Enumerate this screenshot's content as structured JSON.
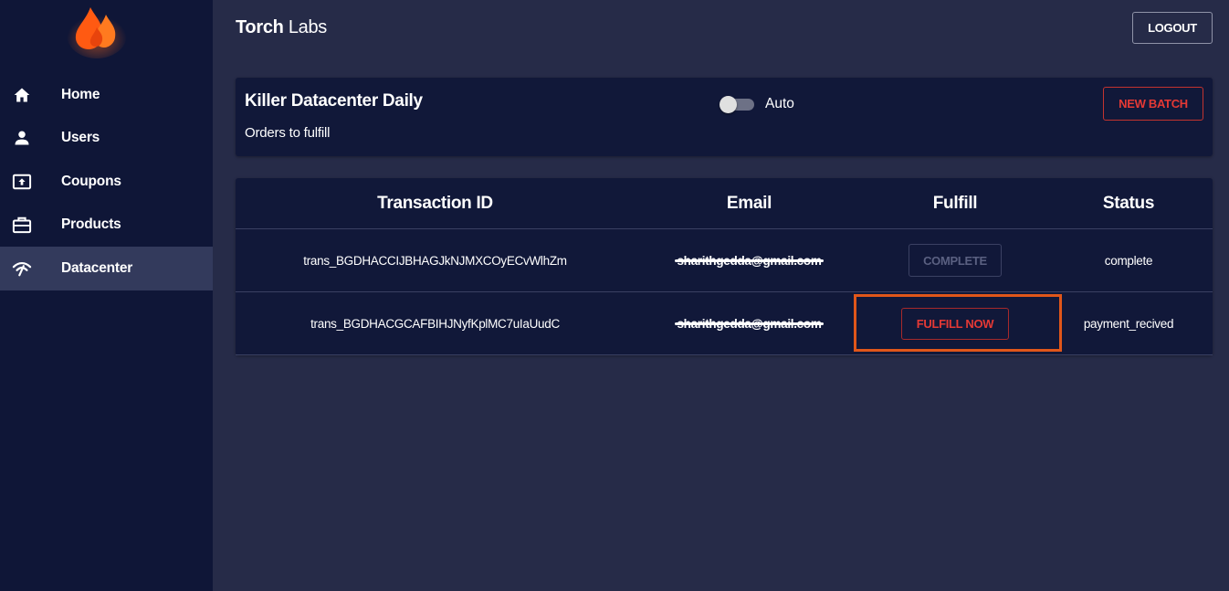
{
  "sidebar": {
    "logo_icon": "flame-logo-icon",
    "items": [
      {
        "label": "Home",
        "icon": "home-icon",
        "active": false
      },
      {
        "label": "Users",
        "icon": "user-icon",
        "active": false
      },
      {
        "label": "Coupons",
        "icon": "coupon-icon",
        "active": false
      },
      {
        "label": "Products",
        "icon": "briefcase-icon",
        "active": false
      },
      {
        "label": "Datacenter",
        "icon": "signal-icon",
        "active": true
      }
    ]
  },
  "header": {
    "brand_bold": "Torch",
    "brand_rest": " Labs",
    "logout_label": "LOGOUT"
  },
  "batch": {
    "title": "Killer Datacenter Daily",
    "subtitle": "Orders to fulfill",
    "toggle_label": "Auto",
    "toggle_on": false,
    "new_batch_label": "NEW BATCH"
  },
  "table": {
    "columns": [
      "Transaction ID",
      "Email",
      "Fulfill",
      "Status"
    ],
    "rows": [
      {
        "transaction_id": "trans_BGDHACCIJBHAGJkNJMXCOyECvWlhZm",
        "email": "sharithgedda@gmail.com",
        "fulfill_label": "COMPLETE",
        "status": "complete"
      },
      {
        "transaction_id": "trans_BGDHACGCAFBIHJNyfKplMC7uIaUudC",
        "email": "sharithgedda@gmail.com",
        "fulfill_label": "FULFILL NOW",
        "status": "payment_recived"
      }
    ]
  },
  "colors": {
    "sidebar_bg": "#0f1637",
    "page_bg": "#262b48",
    "card_bg": "#111839",
    "accent_red": "#e53935",
    "highlight_orange": "#e0561a"
  }
}
